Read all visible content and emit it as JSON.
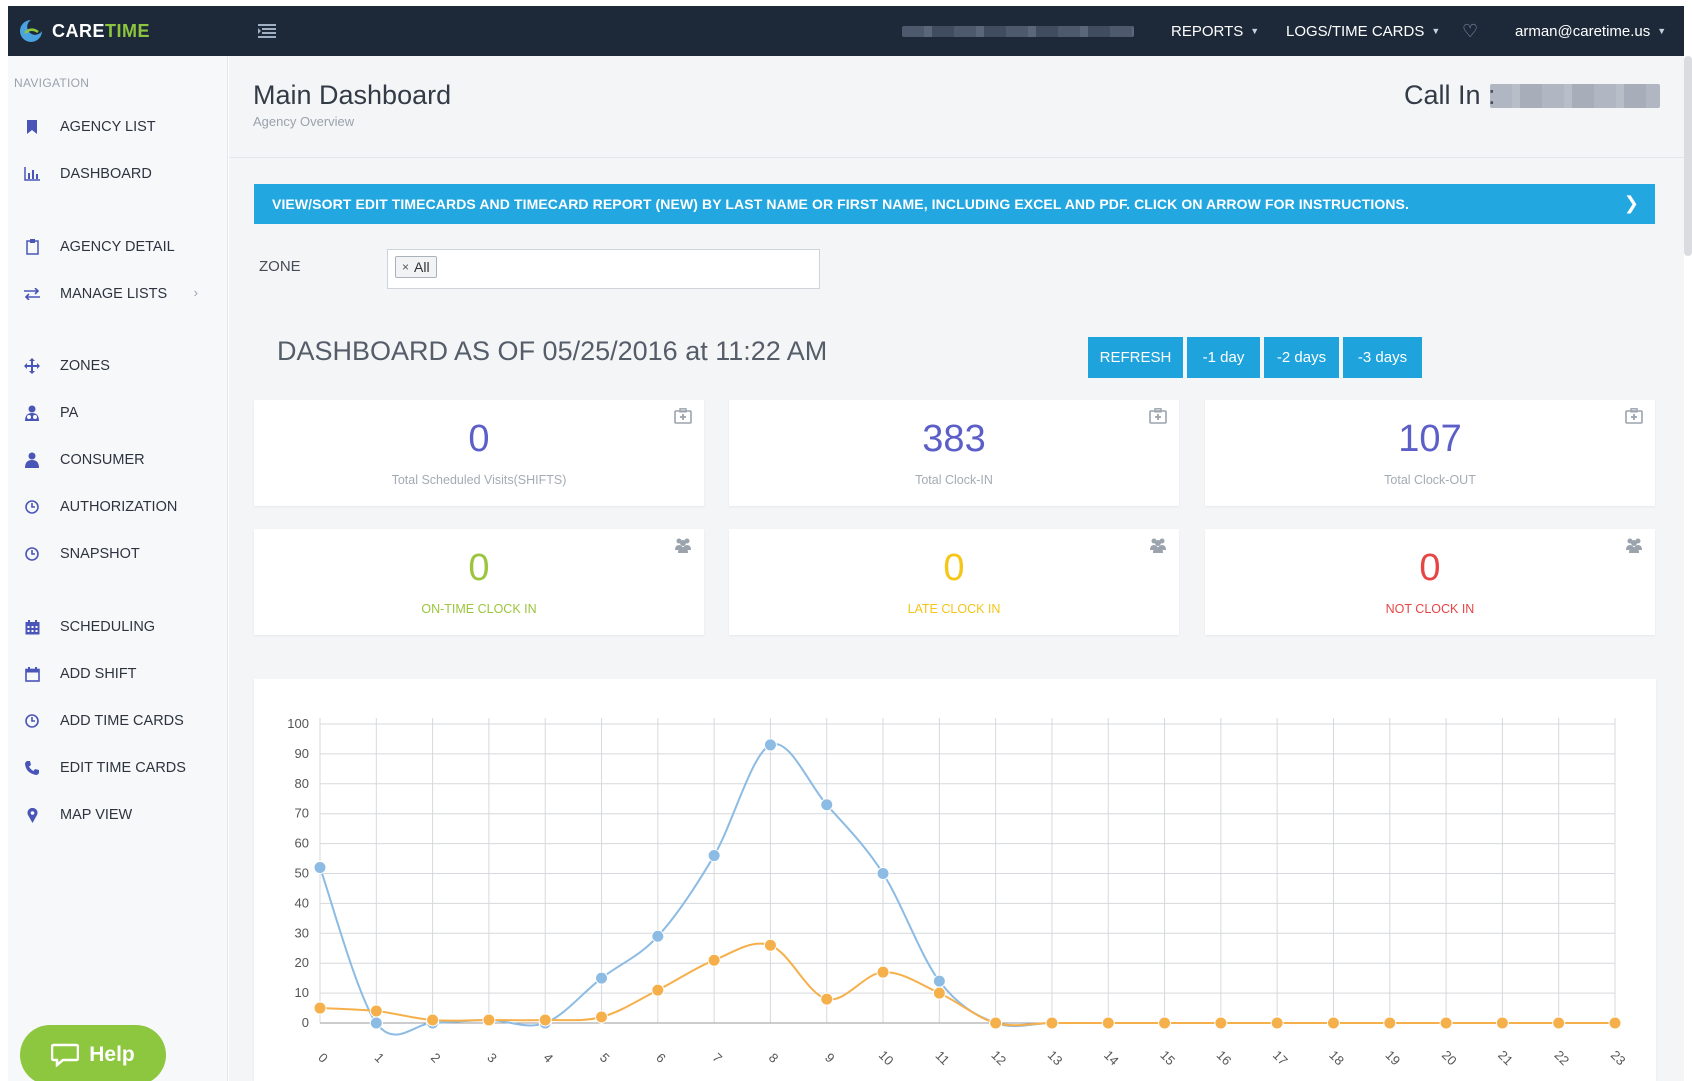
{
  "app": {
    "brand_part1": "CARE",
    "brand_part2": "TIME",
    "brand_color": "#8cc63f"
  },
  "topnav": {
    "reports": "REPORTS",
    "logs": "LOGS/TIME CARDS",
    "user": "arman@caretime.us"
  },
  "sidebar": {
    "heading": "NAVIGATION",
    "items": [
      {
        "label": "AGENCY LIST",
        "icon": "bookmark-icon"
      },
      {
        "label": "DASHBOARD",
        "icon": "bar-chart-icon"
      },
      {
        "label": "AGENCY DETAIL",
        "icon": "clipboard-icon"
      },
      {
        "label": "MANAGE LISTS",
        "icon": "exchange-icon"
      },
      {
        "label": "ZONES",
        "icon": "move-icon"
      },
      {
        "label": "PA",
        "icon": "user-tie-icon"
      },
      {
        "label": "CONSUMER",
        "icon": "user-icon"
      },
      {
        "label": "AUTHORIZATION",
        "icon": "clock-icon"
      },
      {
        "label": "SNAPSHOT",
        "icon": "clock-icon"
      },
      {
        "label": "SCHEDULING",
        "icon": "calendar-icon"
      },
      {
        "label": "ADD SHIFT",
        "icon": "calendar-empty-icon"
      },
      {
        "label": "ADD TIME CARDS",
        "icon": "clock-icon"
      },
      {
        "label": "EDIT TIME CARDS",
        "icon": "phone-icon"
      },
      {
        "label": "MAP VIEW",
        "icon": "map-marker-icon"
      }
    ],
    "help_label": "Help"
  },
  "header": {
    "title": "Main Dashboard",
    "subtitle": "Agency Overview",
    "call_in": "Call In :"
  },
  "banner": {
    "text": "VIEW/SORT EDIT TIMECARDS AND TIMECARD REPORT (NEW) BY LAST NAME OR FIRST NAME, INCLUDING EXCEL AND PDF. CLICK ON ARROW FOR INSTRUCTIONS."
  },
  "zone": {
    "label": "ZONE",
    "selected": "All"
  },
  "dashboard": {
    "title": "DASHBOARD AS OF 05/25/2016 at 11:22 AM",
    "buttons": {
      "refresh": "REFRESH",
      "minus1": "-1 day",
      "minus2": "-2 days",
      "minus3": "-3 days"
    }
  },
  "stats": [
    {
      "value": "0",
      "label": "Total Scheduled Visits(SHIFTS)",
      "icon": "medkit-icon"
    },
    {
      "value": "383",
      "label": "Total Clock-IN",
      "icon": "medkit-icon"
    },
    {
      "value": "107",
      "label": "Total Clock-OUT",
      "icon": "medkit-icon"
    },
    {
      "value": "0",
      "label": "ON-TIME CLOCK IN",
      "icon": "users-icon"
    },
    {
      "value": "0",
      "label": "LATE CLOCK IN",
      "icon": "users-icon"
    },
    {
      "value": "0",
      "label": "NOT CLOCK IN",
      "icon": "users-icon"
    }
  ],
  "colors": {
    "accent": "#22a7e0",
    "stat_purple": "#5b5fc7",
    "on_time": "#9bc53d",
    "late": "#f5c518",
    "not_clock": "#e64545",
    "series_blue": "#8cbbe3",
    "series_orange": "#f5b04b"
  },
  "chart_data": {
    "type": "line",
    "x": [
      0,
      1,
      2,
      3,
      4,
      5,
      6,
      7,
      8,
      9,
      10,
      11,
      12,
      13,
      14,
      15,
      16,
      17,
      18,
      19,
      20,
      21,
      22,
      23
    ],
    "ylim": [
      0,
      100
    ],
    "yticks": [
      0,
      10,
      20,
      30,
      40,
      50,
      60,
      70,
      80,
      90,
      100
    ],
    "grid": true,
    "series": [
      {
        "color": "#8cbbe3",
        "values": [
          52,
          0,
          0,
          1,
          0,
          15,
          29,
          56,
          93,
          73,
          50,
          14,
          0,
          0,
          0,
          0,
          0,
          0,
          0,
          0,
          0,
          0,
          0,
          0
        ]
      },
      {
        "color": "#f5b04b",
        "values": [
          5,
          4,
          1,
          1,
          1,
          2,
          11,
          21,
          26,
          8,
          17,
          10,
          0,
          0,
          0,
          0,
          0,
          0,
          0,
          0,
          0,
          0,
          0,
          0
        ]
      }
    ]
  }
}
